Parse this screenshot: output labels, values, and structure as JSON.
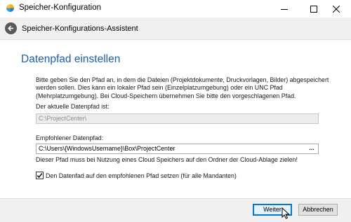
{
  "window": {
    "title": "Speicher-Konfiguration",
    "controls": {
      "minimize": "minimize",
      "maximize": "maximize",
      "close": "close"
    }
  },
  "header": {
    "title": "Speicher-Konfigurations-Assistent",
    "back_icon": "back-arrow-icon"
  },
  "content": {
    "section_title": "Datenpfad einstellen",
    "description": "Bitte geben Sie den Pfad an, in dem die Dateien (Projektdokumente, Druckvorlagen, Bilder) abgespeichert werden sollen. Dies kann ein lokaler Pfad sein (Einzelplatzumgebung) oder ein UNC Pfad (Mehrplatzumgebung). Bei Cloud-Speichern übernehmen Sie bitte den vorgeschlagenen Pfad.",
    "current_path_label": "Der aktuelle Datenpfad ist:",
    "current_path_value": "C:\\ProjectCenter\\",
    "recommended_path_label": "Empfohlener Datenpfad:",
    "recommended_path_value": "C:\\Users\\{WindowsUsername}\\Box\\ProjectCenter",
    "browse_label": "...",
    "hint": "Dieser Pfad muss bei Nutzung eines Cloud Speichers auf den Ordner der Cloud-Ablage zielen!",
    "checkbox_label": "Den Datenfad auf den empfohlenen Pfad setzen (für alle Mandanten)",
    "checkbox_checked": true
  },
  "footer": {
    "next_label": "Weiter",
    "cancel_label": "Abbrechen"
  },
  "colors": {
    "accent": "#1f5fa8",
    "focus_border": "#0078d7"
  }
}
